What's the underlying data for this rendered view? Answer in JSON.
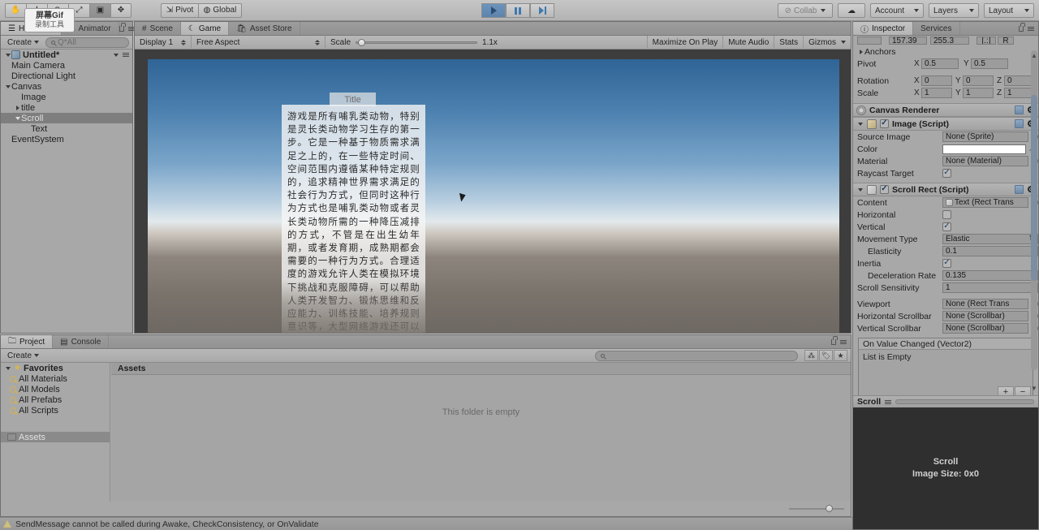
{
  "toolbar": {
    "transform_tools": [
      "hand-tool",
      "move-tool",
      "rotate-tool",
      "scale-tool",
      "rect-tool",
      "transform-tool"
    ],
    "pivot_label": "Pivot",
    "global_label": "Global",
    "collab_label": "Collab",
    "account_label": "Account",
    "layers_label": "Layers",
    "layout_label": "Layout",
    "play_label": "play-button",
    "pause_label": "pause-button",
    "step_label": "step-button"
  },
  "hierarchy": {
    "tab_label": "Hierarchy",
    "animator_tab_label": "Animator",
    "create_label": "Create",
    "search_placeholder": "Q*All",
    "scene_name": "Untitled*",
    "items": [
      {
        "label": "Main Camera",
        "indent": 1,
        "arrow": "none",
        "selected": false
      },
      {
        "label": "Directional Light",
        "indent": 1,
        "arrow": "none",
        "selected": false
      },
      {
        "label": "Canvas",
        "indent": 1,
        "arrow": "down",
        "selected": false
      },
      {
        "label": "Image",
        "indent": 2,
        "arrow": "none",
        "selected": false
      },
      {
        "label": "title",
        "indent": 2,
        "arrow": "right",
        "selected": false
      },
      {
        "label": "Scroll",
        "indent": 2,
        "arrow": "down",
        "selected": true
      },
      {
        "label": "Text",
        "indent": 3,
        "arrow": "none",
        "selected": false
      },
      {
        "label": "EventSystem",
        "indent": 1,
        "arrow": "none",
        "selected": false
      }
    ]
  },
  "gameview": {
    "scene_tab_label": "Scene",
    "game_tab_label": "Game",
    "asset_store_tab_label": "Asset Store",
    "display_label": "Display 1",
    "aspect_label": "Free Aspect",
    "scale_label": "Scale",
    "scale_value": "1.1x",
    "maximize_label": "Maximize On Play",
    "mute_label": "Mute Audio",
    "stats_label": "Stats",
    "gizmos_label": "Gizmos",
    "title_text": "Title",
    "body_text": "游戏是所有哺乳类动物，特别是灵长类动物学习生存的第一步。它是一种基于物质需求满足之上的，在一些特定时间、空间范围内遵循某种特定规则的，追求精神世界需求满足的社会行为方式，但同时这种行为方式也是哺乳类动物或者灵长类动物所需的一种降压减排的方式，不管是在出生幼年期，或者发育期，成熟期都会需要的一种行为方式。合理适度的游戏允许人类在模拟环境下挑战和克服障碍，可以帮助人类开发智力、锻炼思维和反应能力、训练技能、培养规则意识等，大型网络游戏还可以培养战略战术意识和"
  },
  "inspector": {
    "tab_label": "Inspector",
    "services_tab_label": "Services",
    "rect_width_value": "157.39",
    "rect_height_value": "255.3",
    "blueprint_label": "[.:]",
    "raw_label": "R",
    "anchors_label": "Anchors",
    "pivot_label": "Pivot",
    "pivot_x": "0.5",
    "pivot_y": "0.5",
    "rotation_label": "Rotation",
    "rotation_x": "0",
    "rotation_y": "0",
    "rotation_z": "0",
    "scale_label": "Scale",
    "scale_x": "1",
    "scale_y": "1",
    "scale_z": "1",
    "canvas_renderer_label": "Canvas Renderer",
    "image_component_label": "Image (Script)",
    "source_image_label": "Source Image",
    "source_image_value": "None (Sprite)",
    "color_label": "Color",
    "color_value": "#FFFFFF",
    "material_label": "Material",
    "material_value": "None (Material)",
    "raycast_target_label": "Raycast Target",
    "scrollrect_component_label": "Scroll Rect (Script)",
    "content_label": "Content",
    "content_value": "Text (Rect Trans",
    "horizontal_label": "Horizontal",
    "vertical_label": "Vertical",
    "movement_type_label": "Movement Type",
    "movement_type_value": "Elastic",
    "elasticity_label": "Elasticity",
    "elasticity_value": "0.1",
    "inertia_label": "Inertia",
    "deceleration_label": "Deceleration Rate",
    "deceleration_value": "0.135",
    "sensitivity_label": "Scroll Sensitivity",
    "sensitivity_value": "1",
    "viewport_label": "Viewport",
    "viewport_value": "None (Rect Trans",
    "hscrollbar_label": "Horizontal Scrollbar",
    "hscrollbar_value": "None (Scrollbar)",
    "vscrollbar_label": "Vertical Scrollbar",
    "vscrollbar_value": "None (Scrollbar)",
    "event_header": "On Value Changed (Vector2)",
    "event_body": "List is Empty",
    "event_add": "+",
    "event_remove": "−",
    "preview_header": "Scroll",
    "preview_title": "Scroll",
    "preview_size": "Image Size: 0x0"
  },
  "project": {
    "tab_label": "Project",
    "console_tab_label": "Console",
    "create_label": "Create",
    "favorites_label": "Favorites",
    "favorites": [
      "All Materials",
      "All Models",
      "All Prefabs",
      "All Scripts"
    ],
    "assets_tree_label": "Assets",
    "assets_column_label": "Assets",
    "empty_message": "This folder is empty"
  },
  "statusbar": {
    "message": "SendMessage cannot be called during Awake, CheckConsistency, or OnValidate"
  },
  "overlay": {
    "line1": "屏幕Gif",
    "line2": "录制工具"
  }
}
